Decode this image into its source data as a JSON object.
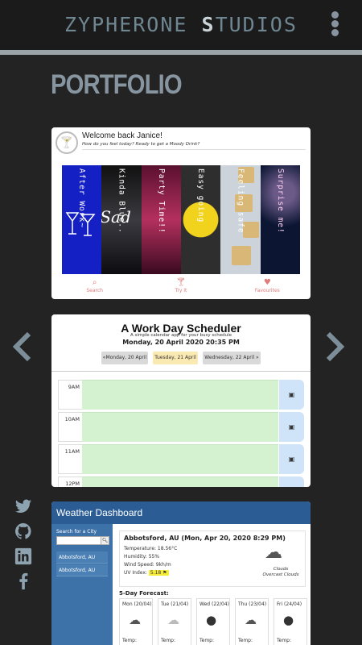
{
  "header": {
    "brand_part1": "ZYPHERONE ",
    "brand_accent": "S",
    "brand_part2": "TUDIOS",
    "menu_icon": "kebab-menu-icon"
  },
  "section_title": "PORTFOLIO",
  "carousel": {
    "prev_icon": "chevron-left-icon",
    "next_icon": "chevron-right-icon"
  },
  "social": [
    "twitter-icon",
    "github-icon",
    "linkedin-icon",
    "facebook-icon"
  ],
  "drinks_card": {
    "welcome": "Welcome back Janice!",
    "subtitle": "How do you feel today? Ready to get a Moody Drink?",
    "moods": [
      {
        "label": "After Work~",
        "color": "#1420c4"
      },
      {
        "label": "Kinda Blue..",
        "color": "#0d0d12"
      },
      {
        "label": "Party Time!!",
        "color": "#8e1a3c"
      },
      {
        "label": "Easy going",
        "color": "#2a2a2a"
      },
      {
        "label": "Feeling safe",
        "color": "#c9b98a"
      },
      {
        "label": "Surprise me!",
        "color": "#0c1633"
      }
    ],
    "sad_overlay": "Sad",
    "nav": [
      {
        "label": "Search",
        "icon": "search-icon"
      },
      {
        "label": "Try it",
        "icon": "cocktail-icon"
      },
      {
        "label": "Favourites",
        "icon": "heart-icon"
      }
    ]
  },
  "scheduler_card": {
    "title": "A Work Day Scheduler",
    "tagline": "A simple calendar app for your busy schedule",
    "date": "Monday, 20 April 2020 20:35 PM",
    "days": [
      "«Monday, 20 April",
      "Tuesday, 21 April",
      "Wednesday, 22 April »"
    ],
    "hours": [
      "9AM",
      "10AM",
      "11AM",
      "12PM"
    ]
  },
  "weather_card": {
    "title": "Weather Dashboard",
    "search_label": "Search for a City",
    "search_value": "",
    "cities": [
      "Abbotsford, AU",
      "Abbotsford, AU"
    ],
    "current": {
      "heading": "Abbotsford, AU (Mon, Apr 20, 2020 8:29 PM)",
      "temperature": "Temperature: 18.56°C",
      "humidity": "Humidity: 55%",
      "wind": "Wind Speed: 9kh/m",
      "uv_label": "UV Index: ",
      "uv_value": "5.18 ⚑",
      "condition": "Clouds",
      "condition_detail": "Overcast Clouds"
    },
    "forecast_heading": "5-Day Forecast:",
    "forecast": [
      {
        "day": "Mon (20/04)",
        "temp": "Temp:"
      },
      {
        "day": "Tue (21/04)",
        "temp": "Temp:"
      },
      {
        "day": "Wed (22/04)",
        "temp": "Temp:"
      },
      {
        "day": "Thu (23/04)",
        "temp": "Temp:"
      },
      {
        "day": "Fri (24/04)",
        "temp": "Temp:"
      }
    ]
  }
}
